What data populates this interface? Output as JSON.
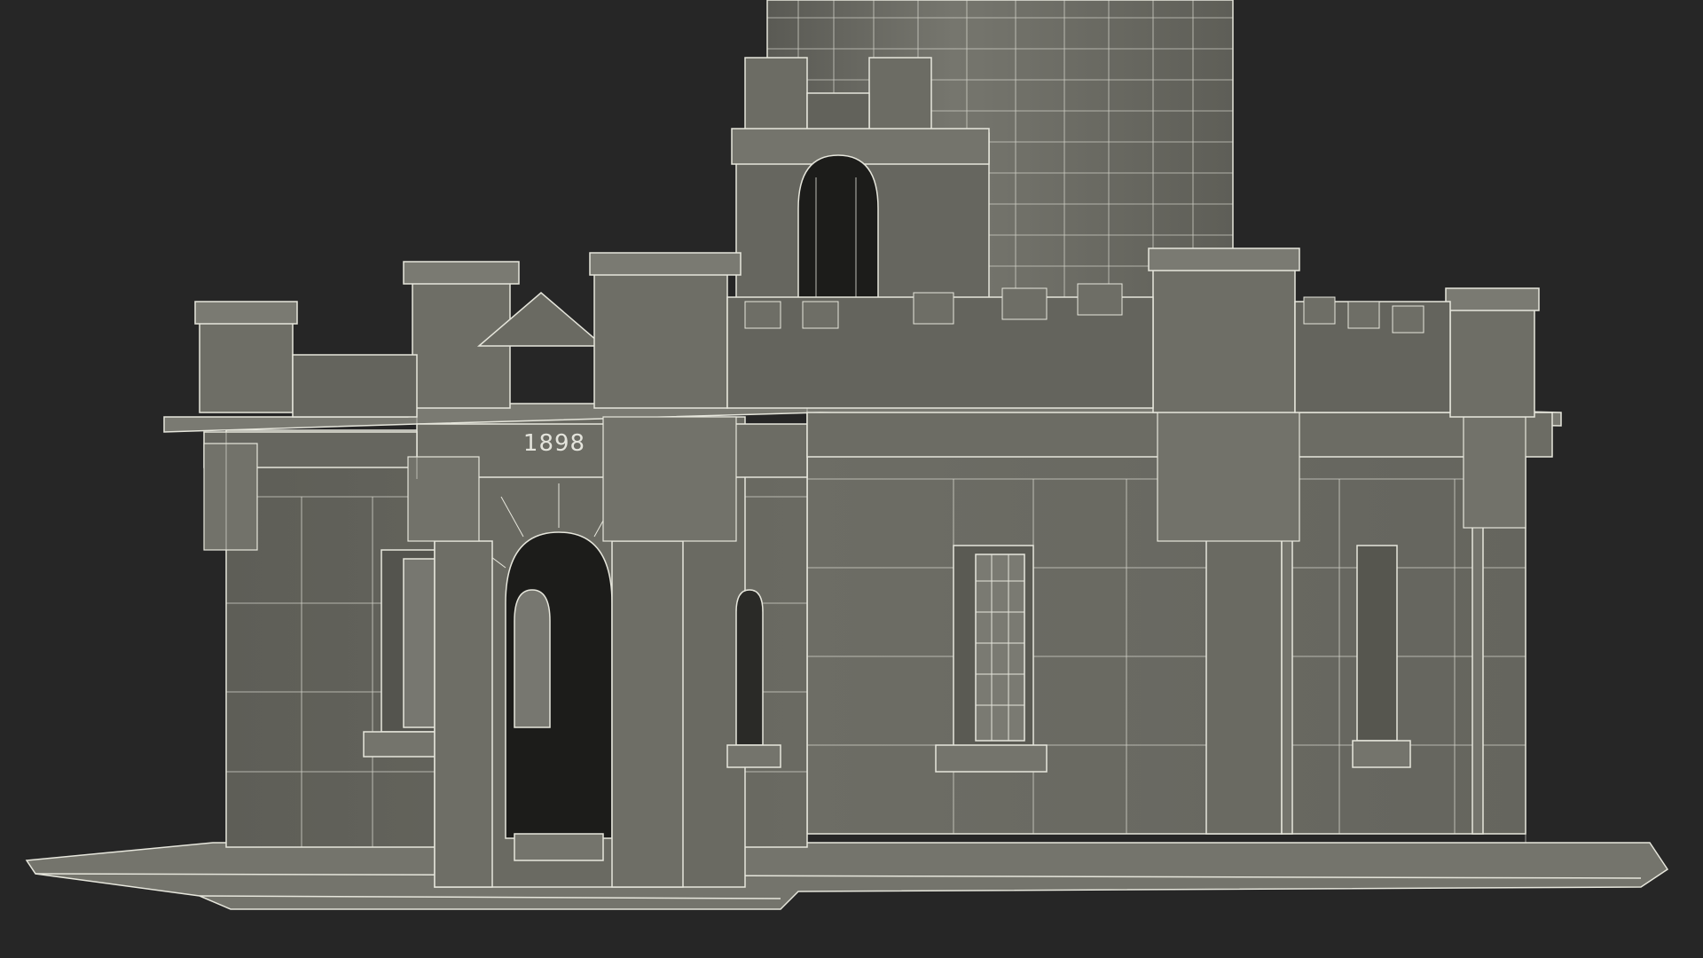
{
  "scene": {
    "background_color": "#262626",
    "wall_color": "#6e6e66",
    "wall_dark_color": "#5c5c55",
    "wire_color": "#e6e6dc",
    "opening_color": "#1c1c1a",
    "plaque_text": "1898"
  }
}
